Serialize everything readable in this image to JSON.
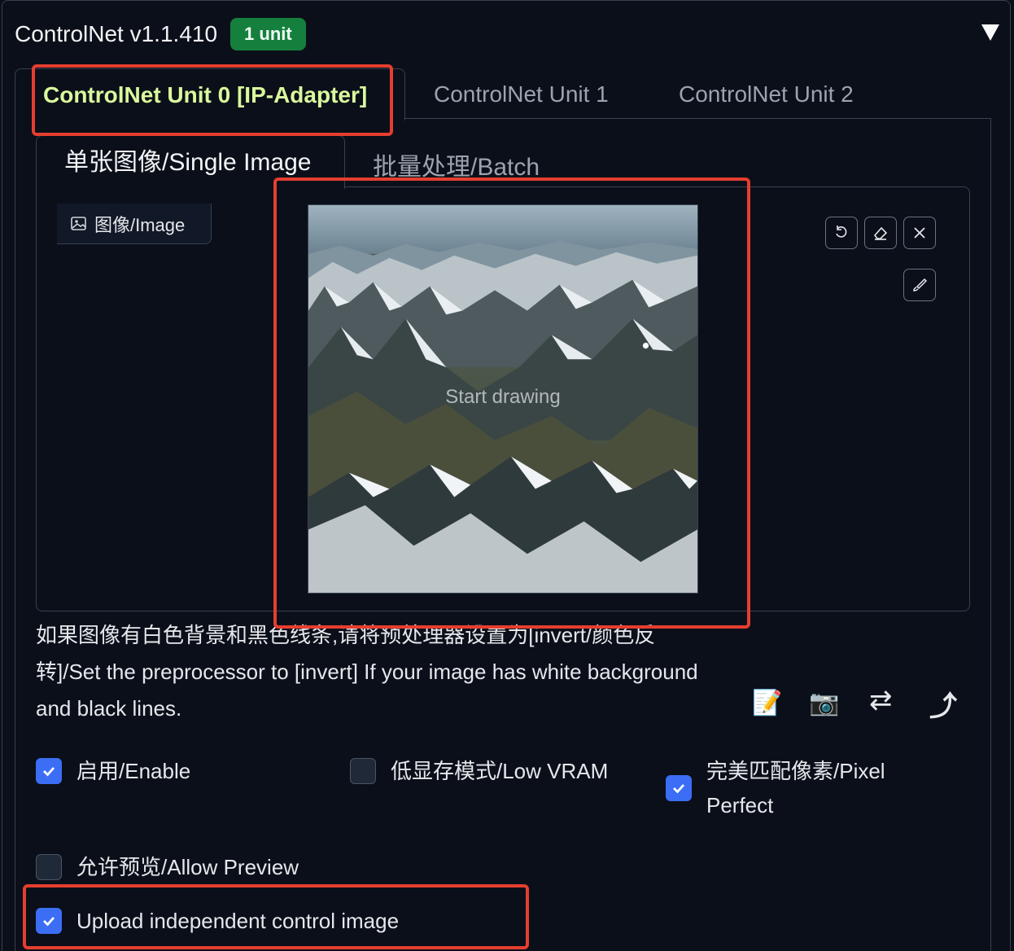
{
  "header": {
    "title": "ControlNet v1.1.410",
    "badge": "1 unit"
  },
  "unit_tabs": [
    {
      "label": "ControlNet Unit 0 [IP-Adapter]",
      "active": true
    },
    {
      "label": "ControlNet Unit 1",
      "active": false
    },
    {
      "label": "ControlNet Unit 2",
      "active": false
    }
  ],
  "inner_tabs": [
    {
      "label": "单张图像/Single Image",
      "active": true
    },
    {
      "label": "批量处理/Batch",
      "active": false
    }
  ],
  "image_input": {
    "label": "图像/Image",
    "canvas_text": "Start drawing",
    "tools": [
      "undo-icon",
      "eraser-icon",
      "close-icon",
      "brush-icon"
    ]
  },
  "hint": {
    "line1": "如果图像有白色背景和黑色线条,请将预处理器设置为[invert/颜色反",
    "line2": "转]/Set the preprocessor to [invert] If your image has white background",
    "line3": "and black lines."
  },
  "actions": {
    "memo": "📝",
    "camera": "📷",
    "swap": "⇄",
    "send": "⤴"
  },
  "options": {
    "enable": {
      "label": "启用/Enable",
      "checked": true
    },
    "low_vram": {
      "label": "低显存模式/Low VRAM",
      "checked": false
    },
    "pixel_perfect": {
      "label_line1": "完美匹配像素/Pixel",
      "label_line2": "Perfect",
      "checked": true
    },
    "allow_preview": {
      "label": "允许预览/Allow Preview",
      "checked": false
    },
    "upload_independent": {
      "label": "Upload independent control image",
      "checked": true
    }
  },
  "colors": {
    "background": "#0b0f19",
    "active_tab": "#d9f99d",
    "badge": "#15803d",
    "checkbox": "#3b6ef5",
    "highlight": "#e53e2f"
  }
}
